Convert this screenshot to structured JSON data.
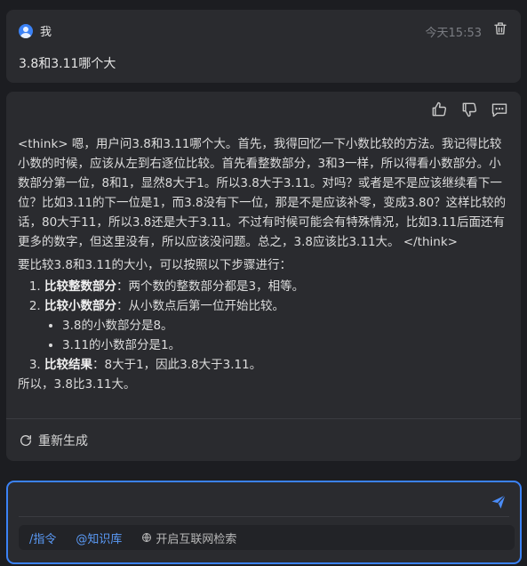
{
  "user_message": {
    "sender": "我",
    "timestamp": "今天15:53",
    "text": "3.8和3.11哪个大"
  },
  "assistant_message": {
    "think": "<think> 嗯，用户问3.8和3.11哪个大。首先，我得回忆一下小数比较的方法。我记得比较小数的时候，应该从左到右逐位比较。首先看整数部分，3和3一样，所以得看小数部分。小数部分第一位，8和1，显然8大于1。所以3.8大于3.11。对吗？或者是不是应该继续看下一位？比如3.11的下一位是1，而3.8没有下一位，那是不是应该补零，变成3.80？这样比较的话，80大于11，所以3.8还是大于3.11。不过有时候可能会有特殊情况，比如3.11后面还有更多的数字，但这里没有，所以应该没问题。总之，3.8应该比3.11大。 </think>",
    "intro": "要比较3.8和3.11的大小，可以按照以下步骤进行：",
    "steps": [
      {
        "title": "比较整数部分",
        "text": "：两个数的整数部分都是3，相等。"
      },
      {
        "title": "比较小数部分",
        "text": "：从小数点后第一位开始比较。"
      },
      {
        "title": "比较结果",
        "text": "：8大于1，因此3.8大于3.11。"
      }
    ],
    "sub_items": [
      "3.8的小数部分是8。",
      "3.11的小数部分是1。"
    ],
    "conclusion": "所以，3.8比3.11大。",
    "regenerate_label": "重新生成"
  },
  "input": {
    "value": "",
    "placeholder": "",
    "commands_label": "/指令",
    "knowledge_label": "@知识库",
    "web_search_label": "开启互联网检索"
  },
  "colors": {
    "accent": "#3b82f6",
    "background": "#1c1d21",
    "card": "#2a2b2f"
  }
}
